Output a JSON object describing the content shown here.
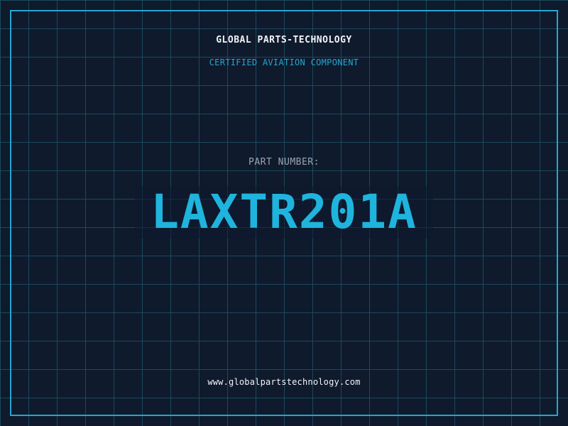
{
  "brand": {
    "name": "GLOBAL PARTS-TECHNOLOGY",
    "tagline": "CERTIFIED AVIATION COMPONENT"
  },
  "part": {
    "label": "PART NUMBER:",
    "number": "LAXTR201A"
  },
  "footer": {
    "website": "www.globalpartstechnology.com"
  },
  "colors": {
    "background": "#0f1a2d",
    "grid": "#1b4a5c",
    "accent": "#22a7cf",
    "text": "#f2f5f8",
    "muted": "#9aa4b2"
  }
}
